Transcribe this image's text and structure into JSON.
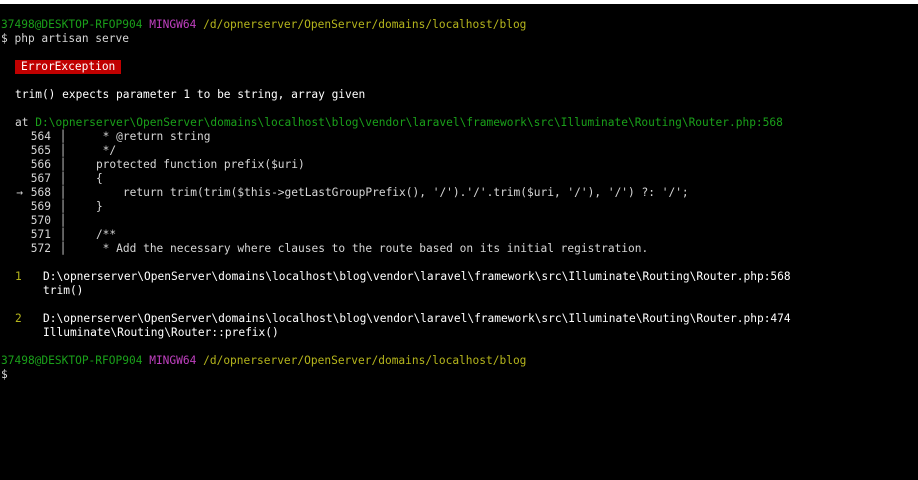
{
  "window": {
    "prompt1": {
      "user_host": "37498@DESKTOP-RFOP904",
      "system": "MINGW64",
      "cwd": "/d/opnerserver/OpenServer/domains/localhost/blog",
      "command": "$ php artisan serve"
    },
    "error": {
      "badge": "ErrorException",
      "message": "trim() expects parameter 1 to be string, array given",
      "at_label": "at",
      "location": "D:\\opnerserver\\OpenServer\\domains\\localhost\\blog\\vendor\\laravel\\framework\\src\\Illuminate\\Routing\\Router.php:568"
    },
    "code_lines": [
      {
        "arrow": "",
        "num": "564",
        "text": "     * @return string"
      },
      {
        "arrow": "",
        "num": "565",
        "text": "     */"
      },
      {
        "arrow": "",
        "num": "566",
        "text": "    protected function prefix($uri)"
      },
      {
        "arrow": "",
        "num": "567",
        "text": "    {"
      },
      {
        "arrow": "→",
        "num": "568",
        "text": "        return trim(trim($this->getLastGroupPrefix(), '/').'/'.trim($uri, '/'), '/') ?: '/';"
      },
      {
        "arrow": "",
        "num": "569",
        "text": "    }"
      },
      {
        "arrow": "",
        "num": "570",
        "text": ""
      },
      {
        "arrow": "",
        "num": "571",
        "text": "    /**"
      },
      {
        "arrow": "",
        "num": "572",
        "text": "     * Add the necessary where clauses to the route based on its initial registration."
      }
    ],
    "trace": [
      {
        "num": "1",
        "file": "D:\\opnerserver\\OpenServer\\domains\\localhost\\blog\\vendor\\laravel\\framework\\src\\Illuminate\\Routing\\Router.php:568",
        "call": "trim()"
      },
      {
        "num": "2",
        "file": "D:\\opnerserver\\OpenServer\\domains\\localhost\\blog\\vendor\\laravel\\framework\\src\\Illuminate\\Routing\\Router.php:474",
        "call": "Illuminate\\Routing\\Router::prefix()"
      }
    ],
    "prompt2": {
      "user_host": "37498@DESKTOP-RFOP904",
      "system": "MINGW64",
      "cwd": "/d/opnerserver/OpenServer/domains/localhost/blog",
      "command": "$"
    }
  },
  "colors": {
    "background": "#000000",
    "user_host": "#1aa01a",
    "system": "#c040c0",
    "path": "#b5b51c",
    "badge_bg": "#c00000"
  }
}
